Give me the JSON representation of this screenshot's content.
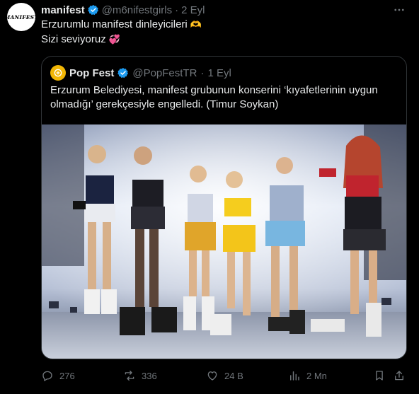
{
  "tweet": {
    "avatar_text": "MANIFEST",
    "author_name": "manifest",
    "handle": "@m6nifestgirls",
    "separator": "·",
    "date": "2 Eyl",
    "line1": "Erzurumlu manifest dinleyicileri",
    "line1_emoji": "🫶",
    "line2": "Sizi seviyoruz",
    "line2_emoji": "💞"
  },
  "quote": {
    "author_name": "Pop Fest",
    "handle": "@PopFestTR",
    "separator": "·",
    "date": "1 Eyl",
    "text": "Erzurum Belediyesi, manifest grubunun konserini ‘kıyafetlerinin uygun olmadığı’ gerekçesiyle engelledi. (Timur Soykan)"
  },
  "actions": {
    "replies": "276",
    "reposts": "336",
    "likes": "24 B",
    "views": "2 Mn"
  },
  "icons": {
    "verified": "verified-badge-icon",
    "more": "more-dots-icon",
    "reply": "reply-icon",
    "repost": "repost-icon",
    "like": "heart-icon",
    "views": "views-chart-icon",
    "bookmark": "bookmark-icon",
    "share": "share-icon"
  },
  "colors": {
    "background": "#000000",
    "text": "#e7e9ea",
    "muted": "#71767b",
    "border": "#2f3336",
    "verified": "#1d9bf0",
    "popfest_avatar": "#f2b705"
  }
}
